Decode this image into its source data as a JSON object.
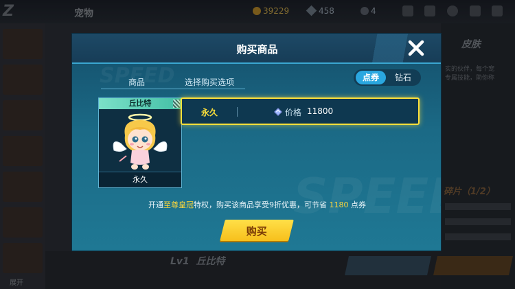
{
  "background": {
    "page_title": "宠物",
    "coins": "39229",
    "diamonds": "458",
    "messages": "4",
    "side_panel_title": "皮肤",
    "side_desc_1": "实的伙伴，每个宠",
    "side_desc_2": "专属技能，助你称",
    "fragment_label": "碎片（1/2）",
    "pet_level": "Lv1",
    "pet_name": "丘比特",
    "expand_label": "展开"
  },
  "dialog": {
    "title": "购买商品",
    "tab_item": "商品",
    "tab_options": "选择购买选项",
    "currency_toggle": {
      "selected": "点券",
      "other": "钻石"
    },
    "item": {
      "name": "丘比特",
      "duration": "永久"
    },
    "purchase_option": {
      "duration": "永久",
      "price_label": "价格",
      "price": "11800"
    },
    "promo": {
      "prefix": "开通",
      "vip": "至尊皇冠",
      "middle": "特权，购买该商品享受9折优惠，可节省",
      "saving": "1180",
      "suffix": "点券"
    },
    "buy_label": "购买",
    "watermark": "SPEED"
  },
  "colors": {
    "accent_yellow": "#ffe13a",
    "toggle_on": "#2aa7e0",
    "dialog_bg": "#1b6a86"
  }
}
